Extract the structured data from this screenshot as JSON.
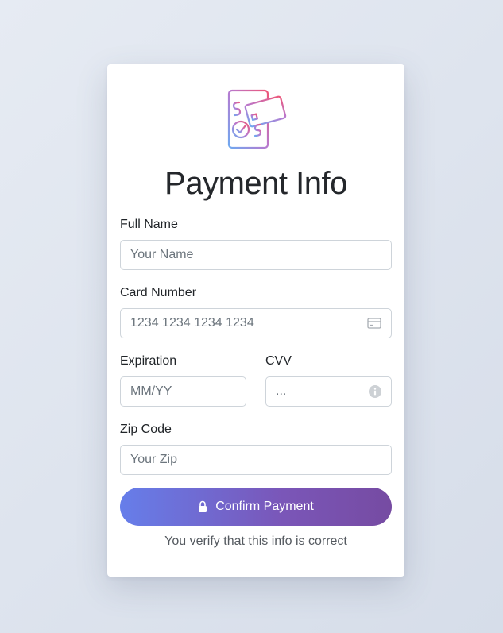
{
  "form": {
    "title": "Payment Info",
    "full_name": {
      "label": "Full Name",
      "placeholder": "Your Name"
    },
    "card_number": {
      "label": "Card Number",
      "placeholder": "1234 1234 1234 1234",
      "icon": "credit-card-icon"
    },
    "expiration": {
      "label": "Expiration",
      "placeholder": "MM/YY"
    },
    "cvv": {
      "label": "CVV",
      "placeholder": "...",
      "icon": "info-icon"
    },
    "zip": {
      "label": "Zip Code",
      "placeholder": "Your Zip"
    },
    "submit": {
      "label": "Confirm Payment",
      "icon": "lock-icon"
    },
    "note": "You verify that this info is correct"
  },
  "logo": {
    "icon": "mobile-payment-icon"
  },
  "colors": {
    "accent_start": "#667eea",
    "accent_end": "#764ba2",
    "logo_start": "#e8507a",
    "logo_end": "#6fa9f0"
  }
}
